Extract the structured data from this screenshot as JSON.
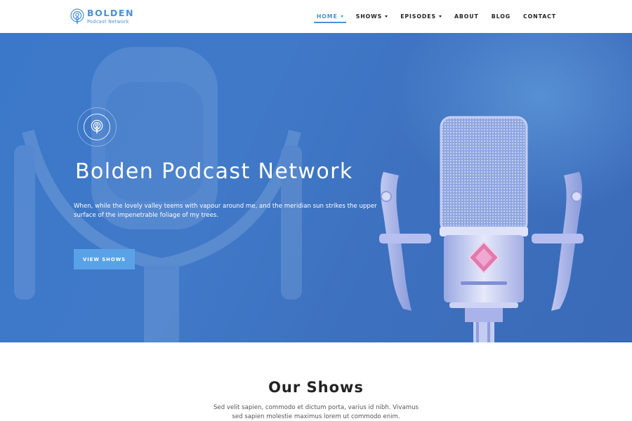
{
  "brand": {
    "name": "BOLDEN",
    "tagline": "Podcast Network",
    "icon": "podcast-icon",
    "accent_color": "#4a90d9"
  },
  "nav": {
    "items": [
      {
        "label": "HOME",
        "active": true,
        "has_dropdown": true
      },
      {
        "label": "SHOWS",
        "active": false,
        "has_dropdown": true
      },
      {
        "label": "EPISODES",
        "active": false,
        "has_dropdown": true
      },
      {
        "label": "ABOUT",
        "active": false,
        "has_dropdown": false
      },
      {
        "label": "BLOG",
        "active": false,
        "has_dropdown": false
      },
      {
        "label": "CONTACT",
        "active": false,
        "has_dropdown": false
      }
    ]
  },
  "hero": {
    "icon": "podcast-icon",
    "title": "Bolden Podcast Network",
    "description": "When, while the lovely valley teems with vapour around me, and the meridian sun strikes the upper surface of the impenetrable foliage of my trees.",
    "button_label": "VIEW SHOWS",
    "image": "studio-microphone",
    "overlay_color": "#3c78c9",
    "button_color": "#5aa2e8"
  },
  "shows": {
    "title": "Our Shows",
    "description": "Sed velit sapien, commodo et dictum porta, varius id nibh. Vivamus sed sapien molestie maximus lorem ut commodo enim."
  }
}
